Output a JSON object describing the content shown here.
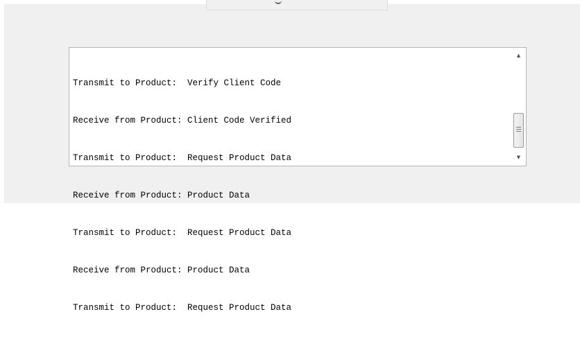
{
  "log": {
    "lines": [
      "Transmit to Product:  Verify Client Code",
      "Receive from Product: Client Code Verified",
      "Transmit to Product:  Request Product Data",
      "Receive from Product: Product Data",
      "Transmit to Product:  Request Product Data",
      "Receive from Product: Product Data",
      "Transmit to Product:  Request Product Data"
    ]
  },
  "scrollbar": {
    "up_icon": "▲",
    "down_icon": "▼"
  }
}
